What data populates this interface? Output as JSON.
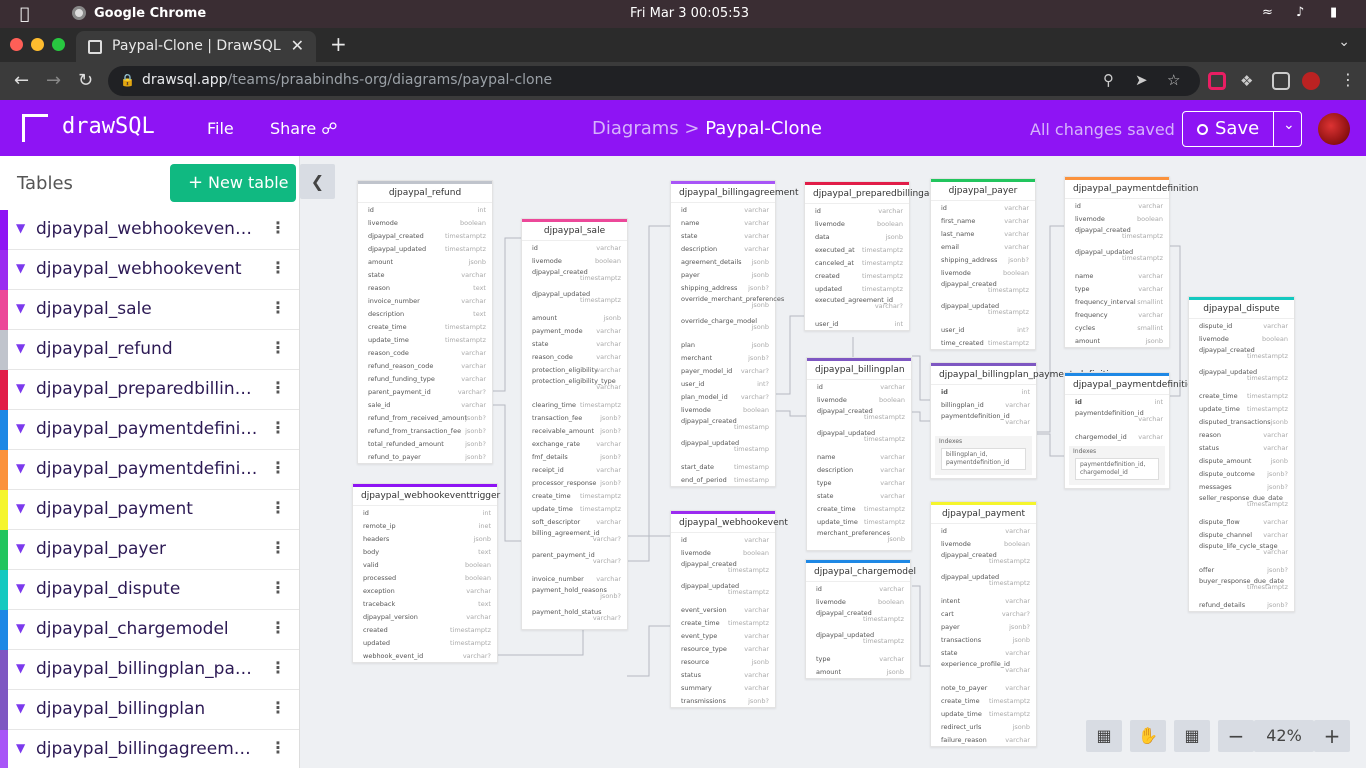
{
  "os": {
    "time": "Fri Mar 3  00:05:53",
    "app": "Google Chrome"
  },
  "browser": {
    "tab_title": "Paypal-Clone | DrawSQL",
    "url_host": "drawsql.app",
    "url_path": "/teams/praabindhs-org/diagrams/paypal-clone"
  },
  "app": {
    "logo": "drawSQL",
    "file": "File",
    "share": "Share",
    "crumb_parent": "Diagrams >",
    "crumb_current": "Paypal-Clone",
    "status": "All changes saved",
    "save": "Save"
  },
  "sidebar": {
    "title": "Tables",
    "new_table": "New table",
    "items": [
      {
        "label": "djpaypal_webhookeventtrigger",
        "color": "#8e14f4"
      },
      {
        "label": "djpaypal_webhookevent",
        "color": "#9b2bf0"
      },
      {
        "label": "djpaypal_sale",
        "color": "#ec4899"
      },
      {
        "label": "djpaypal_refund",
        "color": "#c0c4cc"
      },
      {
        "label": "djpaypal_preparedbillingagreement",
        "color": "#e11d48"
      },
      {
        "label": "djpaypal_paymentdefinition_charge_models",
        "color": "#1e88e5"
      },
      {
        "label": "djpaypal_paymentdefinition",
        "color": "#fb923c"
      },
      {
        "label": "djpaypal_payment",
        "color": "#f5f52c"
      },
      {
        "label": "djpaypal_payer",
        "color": "#22c55e"
      },
      {
        "label": "djpaypal_dispute",
        "color": "#14c9c0"
      },
      {
        "label": "djpaypal_chargemodel",
        "color": "#1e88e5"
      },
      {
        "label": "djpaypal_billingplan_payment_definitions",
        "color": "#7e57c2"
      },
      {
        "label": "djpaypal_billingplan",
        "color": "#7e57c2"
      },
      {
        "label": "djpaypal_billingagreement",
        "color": "#a855f7"
      }
    ]
  },
  "zoom": "42%",
  "tables": [
    {
      "title": "djpaypal_refund",
      "color": "#c0c4cc",
      "cols": [
        [
          "id",
          "int"
        ],
        [
          "livemode",
          "boolean"
        ],
        [
          "djpaypal_created",
          "timestamptz"
        ],
        [
          "djpaypal_updated",
          "timestamptz"
        ],
        [
          "amount",
          "jsonb"
        ],
        [
          "state",
          "varchar"
        ],
        [
          "reason",
          "text"
        ],
        [
          "invoice_number",
          "varchar"
        ],
        [
          "description",
          "text"
        ],
        [
          "create_time",
          "timestamptz"
        ],
        [
          "update_time",
          "timestamptz"
        ],
        [
          "reason_code",
          "varchar"
        ],
        [
          "refund_reason_code",
          "varchar"
        ],
        [
          "refund_funding_type",
          "varchar"
        ],
        [
          "parent_payment_id",
          "varchar?"
        ],
        [
          "sale_id",
          "varchar"
        ],
        [
          "refund_from_received_amount",
          "jsonb?"
        ],
        [
          "refund_from_transaction_fee",
          "jsonb?"
        ],
        [
          "total_refunded_amount",
          "jsonb?"
        ],
        [
          "refund_to_payer",
          "jsonb?"
        ]
      ]
    },
    {
      "title": "djpaypal_webhookeventtrigger",
      "color": "#8e14f4",
      "cols": [
        [
          "id",
          "int"
        ],
        [
          "remote_ip",
          "inet"
        ],
        [
          "headers",
          "jsonb"
        ],
        [
          "body",
          "text"
        ],
        [
          "valid",
          "boolean"
        ],
        [
          "processed",
          "boolean"
        ],
        [
          "exception",
          "varchar"
        ],
        [
          "traceback",
          "text"
        ],
        [
          "djpaypal_version",
          "varchar"
        ],
        [
          "created",
          "timestamptz"
        ],
        [
          "updated",
          "timestamptz"
        ],
        [
          "webhook_event_id",
          "varchar?"
        ]
      ]
    },
    {
      "title": "djpaypal_sale",
      "color": "#ec4899",
      "cols": [
        [
          "id",
          "varchar"
        ],
        [
          "livemode",
          "boolean"
        ],
        [
          "djpaypal_created",
          "timestamptz"
        ],
        [
          "djpaypal_updated",
          "timestamptz"
        ],
        [
          "amount",
          "jsonb"
        ],
        [
          "payment_mode",
          "varchar"
        ],
        [
          "state",
          "varchar"
        ],
        [
          "reason_code",
          "varchar"
        ],
        [
          "protection_eligibility",
          "varchar"
        ],
        [
          "protection_eligibility_type",
          "varchar"
        ],
        [
          "clearing_time",
          "timestamptz"
        ],
        [
          "transaction_fee",
          "jsonb?"
        ],
        [
          "receivable_amount",
          "jsonb?"
        ],
        [
          "exchange_rate",
          "varchar"
        ],
        [
          "fmf_details",
          "jsonb?"
        ],
        [
          "receipt_id",
          "varchar"
        ],
        [
          "processor_response",
          "jsonb?"
        ],
        [
          "create_time",
          "timestamptz"
        ],
        [
          "update_time",
          "timestamptz"
        ],
        [
          "soft_descriptor",
          "varchar"
        ],
        [
          "billing_agreement_id",
          "varchar?"
        ],
        [
          "parent_payment_id",
          "varchar?"
        ],
        [
          "invoice_number",
          "varchar"
        ],
        [
          "payment_hold_reasons",
          "jsonb?"
        ],
        [
          "payment_hold_status",
          "varchar?"
        ]
      ]
    },
    {
      "title": "djpaypal_billingagreement",
      "color": "#a855f7",
      "cols": [
        [
          "id",
          "varchar"
        ],
        [
          "name",
          "varchar"
        ],
        [
          "state",
          "varchar"
        ],
        [
          "description",
          "varchar"
        ],
        [
          "agreement_details",
          "jsonb"
        ],
        [
          "payer",
          "jsonb"
        ],
        [
          "shipping_address",
          "jsonb?"
        ],
        [
          "override_merchant_preferences",
          "jsonb"
        ],
        [
          "override_charge_model",
          "jsonb"
        ],
        [
          "plan",
          "jsonb"
        ],
        [
          "merchant",
          "jsonb?"
        ],
        [
          "payer_model_id",
          "varchar?"
        ],
        [
          "user_id",
          "int?"
        ],
        [
          "plan_model_id",
          "varchar?"
        ],
        [
          "livemode",
          "boolean"
        ],
        [
          "djpaypal_created",
          "timestamp"
        ],
        [
          "djpaypal_updated",
          "timestamp"
        ],
        [
          "start_date",
          "timestamp"
        ],
        [
          "end_of_period",
          "timestamp"
        ]
      ]
    },
    {
      "title": "djpaypal_webhookevent",
      "color": "#9b2bf0",
      "cols": [
        [
          "id",
          "varchar"
        ],
        [
          "livemode",
          "boolean"
        ],
        [
          "djpaypal_created",
          "timestamptz"
        ],
        [
          "djpaypal_updated",
          "timestamptz"
        ],
        [
          "event_version",
          "varchar"
        ],
        [
          "create_time",
          "timestamptz"
        ],
        [
          "event_type",
          "varchar"
        ],
        [
          "resource_type",
          "varchar"
        ],
        [
          "resource",
          "jsonb"
        ],
        [
          "status",
          "varchar"
        ],
        [
          "summary",
          "varchar"
        ],
        [
          "transmissions",
          "jsonb?"
        ]
      ]
    },
    {
      "title": "djpaypal_preparedbillingagreement",
      "color": "#e11d48",
      "cols": [
        [
          "id",
          "varchar"
        ],
        [
          "livemode",
          "boolean"
        ],
        [
          "data",
          "jsonb"
        ],
        [
          "executed_at",
          "timestamptz"
        ],
        [
          "canceled_at",
          "timestamptz"
        ],
        [
          "created",
          "timestamptz"
        ],
        [
          "updated",
          "timestamptz"
        ],
        [
          "executed_agreement_id",
          "varchar?"
        ],
        [
          "user_id",
          "int"
        ]
      ]
    },
    {
      "title": "djpaypal_billingplan",
      "color": "#7e57c2",
      "cols": [
        [
          "id",
          "varchar"
        ],
        [
          "livemode",
          "boolean"
        ],
        [
          "djpaypal_created",
          "timestamptz"
        ],
        [
          "djpaypal_updated",
          "timestamptz"
        ],
        [
          "name",
          "varchar"
        ],
        [
          "description",
          "varchar"
        ],
        [
          "type",
          "varchar"
        ],
        [
          "state",
          "varchar"
        ],
        [
          "create_time",
          "timestamptz"
        ],
        [
          "update_time",
          "timestamptz"
        ],
        [
          "merchant_preferences",
          "jsonb"
        ]
      ]
    },
    {
      "title": "djpaypal_chargemodel",
      "color": "#1e88e5",
      "cols": [
        [
          "id",
          "varchar"
        ],
        [
          "livemode",
          "boolean"
        ],
        [
          "djpaypal_created",
          "timestamptz"
        ],
        [
          "djpaypal_updated",
          "timestamptz"
        ],
        [
          "type",
          "varchar"
        ],
        [
          "amount",
          "jsonb"
        ]
      ]
    },
    {
      "title": "djpaypal_payer",
      "color": "#22c55e",
      "cols": [
        [
          "id",
          "varchar"
        ],
        [
          "first_name",
          "varchar"
        ],
        [
          "last_name",
          "varchar"
        ],
        [
          "email",
          "varchar"
        ],
        [
          "shipping_address",
          "jsonb?"
        ],
        [
          "livemode",
          "boolean"
        ],
        [
          "djpaypal_created",
          "timestamptz"
        ],
        [
          "djpaypal_updated",
          "timestamptz"
        ],
        [
          "user_id",
          "int?"
        ],
        [
          "time_created",
          "timestamptz"
        ]
      ]
    },
    {
      "title": "djpaypal_billingplan_payment_definitions",
      "color": "#7e57c2",
      "cols": [
        [
          "id",
          "int"
        ],
        [
          "billingplan_id",
          "varchar"
        ],
        [
          "paymentdefinition_id",
          "varchar"
        ]
      ],
      "index": [
        "billingplan_id,",
        "paymentdefinition_id"
      ]
    },
    {
      "title": "djpaypal_payment",
      "color": "#f5f52c",
      "cols": [
        [
          "id",
          "varchar"
        ],
        [
          "livemode",
          "boolean"
        ],
        [
          "djpaypal_created",
          "timestamptz"
        ],
        [
          "djpaypal_updated",
          "timestamptz"
        ],
        [
          "intent",
          "varchar"
        ],
        [
          "cart",
          "varchar?"
        ],
        [
          "payer",
          "jsonb?"
        ],
        [
          "transactions",
          "jsonb"
        ],
        [
          "state",
          "varchar"
        ],
        [
          "experience_profile_id",
          "varchar"
        ],
        [
          "note_to_payer",
          "varchar"
        ],
        [
          "create_time",
          "timestamptz"
        ],
        [
          "update_time",
          "timestamptz"
        ],
        [
          "redirect_urls",
          "jsonb"
        ],
        [
          "failure_reason",
          "varchar"
        ]
      ]
    },
    {
      "title": "djpaypal_paymentdefinition",
      "color": "#fb923c",
      "cols": [
        [
          "id",
          "varchar"
        ],
        [
          "livemode",
          "boolean"
        ],
        [
          "djpaypal_created",
          "timestamptz"
        ],
        [
          "djpaypal_updated",
          "timestamptz"
        ],
        [
          "name",
          "varchar"
        ],
        [
          "type",
          "varchar"
        ],
        [
          "frequency_interval",
          "smallint"
        ],
        [
          "frequency",
          "varchar"
        ],
        [
          "cycles",
          "smallint"
        ],
        [
          "amount",
          "jsonb"
        ]
      ]
    },
    {
      "title": "djpaypal_paymentdefinition_charge_models",
      "color": "#1e88e5",
      "cols": [
        [
          "id",
          "int"
        ],
        [
          "paymentdefinition_id",
          "varchar"
        ],
        [
          "chargemodel_id",
          "varchar"
        ]
      ],
      "index": [
        "paymentdefinition_id,",
        "chargemodel_id"
      ]
    },
    {
      "title": "djpaypal_dispute",
      "color": "#14c9c0",
      "cols": [
        [
          "dispute_id",
          "varchar"
        ],
        [
          "livemode",
          "boolean"
        ],
        [
          "djpaypal_created",
          "timestamptz"
        ],
        [
          "djpaypal_updated",
          "timestamptz"
        ],
        [
          "create_time",
          "timestamptz"
        ],
        [
          "update_time",
          "timestamptz"
        ],
        [
          "disputed_transactions",
          "jsonb"
        ],
        [
          "reason",
          "varchar"
        ],
        [
          "status",
          "varchar"
        ],
        [
          "dispute_amount",
          "jsonb"
        ],
        [
          "dispute_outcome",
          "jsonb?"
        ],
        [
          "messages",
          "jsonb?"
        ],
        [
          "seller_response_due_date",
          "timestamptz"
        ],
        [
          "dispute_flow",
          "varchar"
        ],
        [
          "dispute_channel",
          "varchar"
        ],
        [
          "dispute_life_cycle_stage",
          "varchar"
        ],
        [
          "offer",
          "jsonb?"
        ],
        [
          "buyer_response_due_date",
          "timestamptz"
        ],
        [
          "refund_details",
          "jsonb?"
        ]
      ]
    }
  ],
  "indexes_label": "Indexes"
}
